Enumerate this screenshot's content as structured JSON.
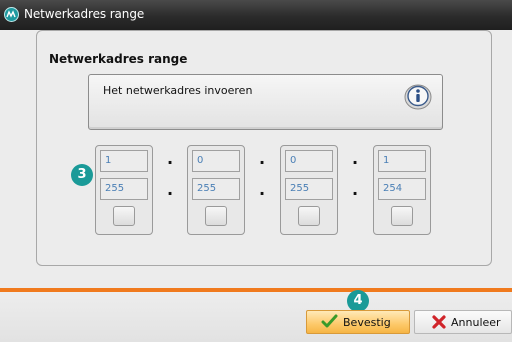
{
  "window": {
    "title": "Netwerkadres range",
    "title_icon": "app-logo-icon"
  },
  "group": {
    "label": "Netwerkadres range"
  },
  "info": {
    "text": "Het netwerkadres invoeren",
    "icon": "info-icon"
  },
  "octets": [
    {
      "start": "1",
      "end": "255"
    },
    {
      "start": "0",
      "end": "255"
    },
    {
      "start": "0",
      "end": "255"
    },
    {
      "start": "1",
      "end": "254"
    }
  ],
  "separators": [
    ".",
    ".",
    ".",
    ".",
    ".",
    "."
  ],
  "callouts": {
    "octets": "3",
    "confirm": "4"
  },
  "buttons": {
    "confirm": "Bevestig",
    "cancel": "Annuleer"
  },
  "colors": {
    "accent_orange": "#f07a1e",
    "callout_teal": "#1a9a98",
    "field_value_blue": "#4a7fb5"
  }
}
